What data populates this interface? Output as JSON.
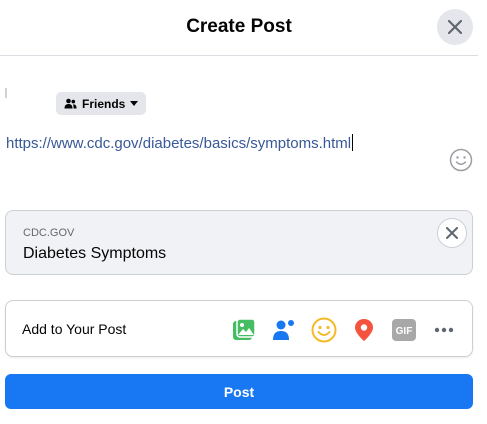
{
  "header": {
    "title": "Create Post",
    "close_icon": "close-icon"
  },
  "audience": {
    "label": "Friends",
    "icon": "people-icon",
    "dropdown_icon": "caret-down-icon"
  },
  "composer": {
    "text": "https://www.cdc.gov/diabetes/basics/symptoms.html",
    "emoji_icon": "smiley-icon"
  },
  "link_preview": {
    "domain": "CDC.GOV",
    "title": "Diabetes Symptoms",
    "remove_icon": "close-icon"
  },
  "add_to_post": {
    "label": "Add to Your Post",
    "items": [
      {
        "icon": "photo-video-icon",
        "color": "#45bd62"
      },
      {
        "icon": "tag-people-icon",
        "color": "#1877f2"
      },
      {
        "icon": "feeling-icon",
        "color": "#f7b928"
      },
      {
        "icon": "location-icon",
        "color": "#f5533d"
      },
      {
        "icon": "gif-icon",
        "color": "#a8a8a8",
        "text": "GIF"
      },
      {
        "icon": "more-icon",
        "color": "#606770"
      }
    ]
  },
  "post_button": {
    "label": "Post",
    "color": "#1877f2"
  }
}
